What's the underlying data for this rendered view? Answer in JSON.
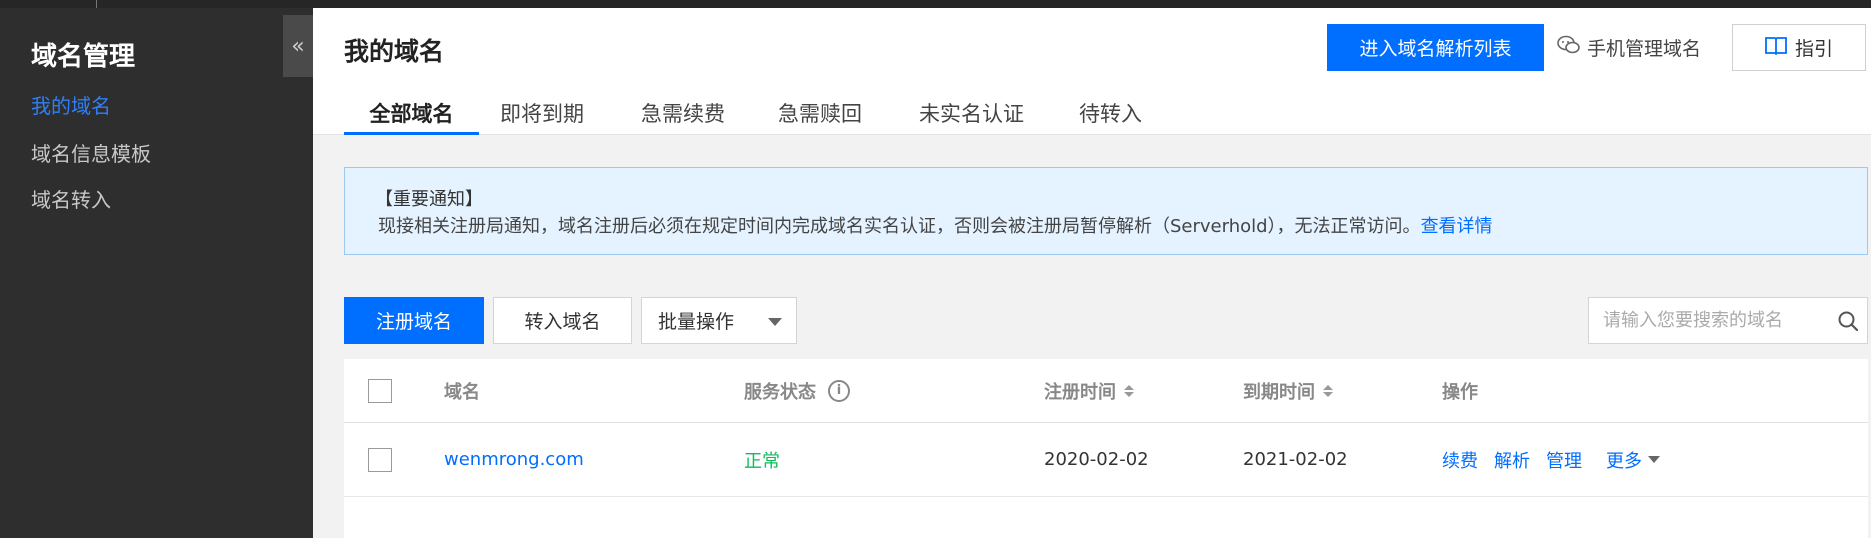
{
  "sidebar": {
    "title": "域名管理",
    "collapse_glyph": "«",
    "items": [
      {
        "label": "我的域名",
        "active": true
      },
      {
        "label": "域名信息模板",
        "active": false
      },
      {
        "label": "域名转入",
        "active": false
      }
    ]
  },
  "header": {
    "title": "我的域名",
    "primary_button": "进入域名解析列表",
    "mobile_link": "手机管理域名",
    "guide_button": "指引",
    "tabs": [
      {
        "label": "全部域名",
        "active": true
      },
      {
        "label": "即将到期",
        "active": false
      },
      {
        "label": "急需续费",
        "active": false
      },
      {
        "label": "急需赎回",
        "active": false
      },
      {
        "label": "未实名认证",
        "active": false
      },
      {
        "label": "待转入",
        "active": false
      }
    ]
  },
  "notice": {
    "title": "【重要通知】",
    "body": "现接相关注册局通知，域名注册后必须在规定时间内完成域名实名认证，否则会被注册局暂停解析（Serverhold），无法正常访问。",
    "link": "查看详情"
  },
  "toolbar": {
    "register_label": "注册域名",
    "transfer_label": "转入域名",
    "batch_label": "批量操作",
    "search_placeholder": "请输入您要搜索的域名"
  },
  "table": {
    "headers": {
      "domain": "域名",
      "status": "服务状态",
      "reg_time": "注册时间",
      "exp_time": "到期时间",
      "actions": "操作"
    },
    "rows": [
      {
        "domain": "wenmrong.com",
        "status": "正常",
        "reg_time": "2020-02-02",
        "exp_time": "2021-02-02",
        "actions": [
          "续费",
          "解析",
          "管理"
        ],
        "more": "更多"
      }
    ]
  },
  "colors": {
    "accent": "#006eff",
    "status_ok": "#0abf5b",
    "sidebar_bg": "#2e2e2e",
    "sidebar_active": "#2f7ff7",
    "notice_bg": "#e5f2ff"
  },
  "icons": {
    "collapse": "double-chevron-left-icon",
    "mobile": "wechat-icon",
    "guide": "book-icon",
    "search": "search-icon",
    "info": "info-icon",
    "sort": "sort-icon",
    "dropdown": "caret-down-icon"
  }
}
